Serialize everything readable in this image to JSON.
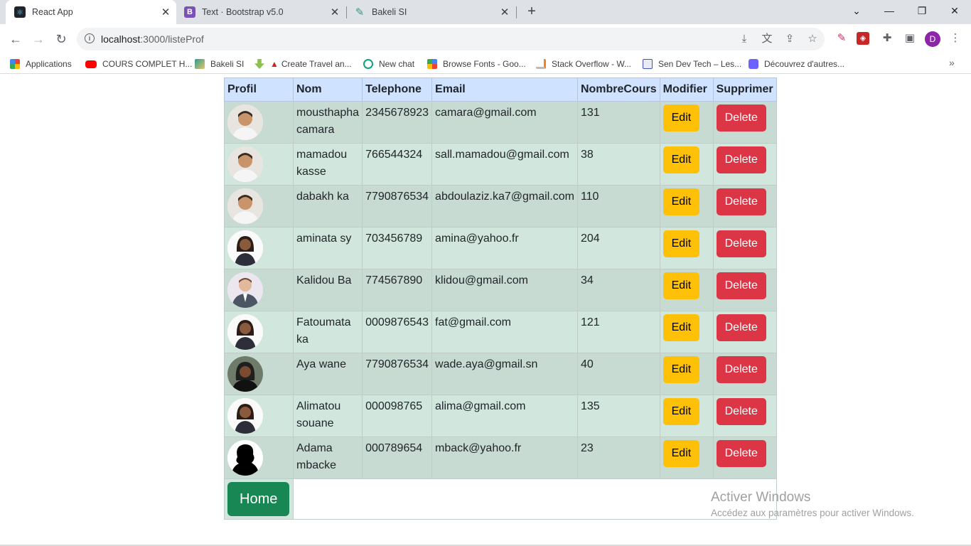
{
  "browser": {
    "tabs": [
      {
        "title": "React App",
        "active": true,
        "favicon": "react-icon",
        "color": "#20232a"
      },
      {
        "title": "Text · Bootstrap v5.0",
        "active": false,
        "favicon": "bootstrap-icon",
        "color": "#7952b3"
      },
      {
        "title": "Bakeli SI",
        "active": false,
        "favicon": "bakeli-icon",
        "color": "#2a9d8f"
      }
    ],
    "new_tab": "+",
    "url_host": "localhost",
    "url_path": ":3000/listeProf",
    "profile_initial": "D",
    "bookmarks": [
      {
        "label": "Applications",
        "icon": "apps-grid-icon",
        "color": "#ea4335"
      },
      {
        "label": "COURS COMPLET H...",
        "icon": "youtube-icon",
        "color": "#ff0000"
      },
      {
        "label": "Bakeli SI",
        "icon": "bakeli-icon",
        "color": "#2a9d8f"
      },
      {
        "label": "Create Travel an...",
        "icon": "download-arrow-icon",
        "color": "#8bc34a"
      },
      {
        "label": "New chat",
        "icon": "openai-icon",
        "color": "#10a37f"
      },
      {
        "label": "Browse Fonts - Goo...",
        "icon": "google-fonts-icon",
        "color": "#4285f4"
      },
      {
        "label": "Stack Overflow - W...",
        "icon": "stackoverflow-icon",
        "color": "#f48024"
      },
      {
        "label": "Sen Dev Tech – Les...",
        "icon": "sendevtech-icon",
        "color": "#3f51b5"
      },
      {
        "label": "Découvrez d'autres...",
        "icon": "discover-icon",
        "color": "#6c63ff"
      }
    ]
  },
  "table": {
    "headers": [
      "Profil",
      "Nom",
      "Telephone",
      "Email",
      "NombreCours",
      "Modifier",
      "Supprimer"
    ],
    "edit_label": "Edit",
    "delete_label": "Delete",
    "rows": [
      {
        "nom": "mousthapha camara",
        "telephone": "2345678923",
        "email": "camara@gmail.com",
        "nombreCours": "131",
        "avatar": "man-avatar"
      },
      {
        "nom": "mamadou kasse",
        "telephone": "766544324",
        "email": "sall.mamadou@gmail.com",
        "nombreCours": "38",
        "avatar": "man-avatar"
      },
      {
        "nom": "dabakh ka",
        "telephone": "7790876534",
        "email": "abdoulaziz.ka7@gmail.com",
        "nombreCours": "110",
        "avatar": "man-avatar"
      },
      {
        "nom": "aminata sy",
        "telephone": "703456789",
        "email": "amina@yahoo.fr",
        "nombreCours": "204",
        "avatar": "woman-avatar"
      },
      {
        "nom": "Kalidou Ba",
        "telephone": "774567890",
        "email": "klidou@gmail.com",
        "nombreCours": "34",
        "avatar": "man-suit-avatar"
      },
      {
        "nom": "Fatoumata ka",
        "telephone": "0009876543",
        "email": "fat@gmail.com",
        "nombreCours": "121",
        "avatar": "woman-avatar"
      },
      {
        "nom": "Aya wane",
        "telephone": "7790876534",
        "email": "wade.aya@gmail.sn",
        "nombreCours": "40",
        "avatar": "woman-hijab-avatar"
      },
      {
        "nom": "Alimatou souane",
        "telephone": "000098765",
        "email": "alima@gmail.com",
        "nombreCours": "135",
        "avatar": "woman-avatar"
      },
      {
        "nom": "Adama mbacke",
        "telephone": "000789654",
        "email": "mback@yahoo.fr",
        "nombreCours": "23",
        "avatar": "silhouette-avatar"
      }
    ]
  },
  "home_label": "Home",
  "watermark": {
    "title": "Activer Windows",
    "subtitle": "Accédez aux paramètres pour activer Windows."
  }
}
